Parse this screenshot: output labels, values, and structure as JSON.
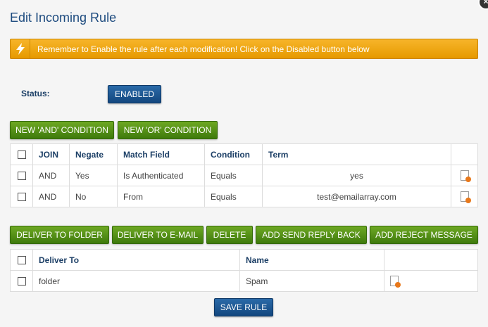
{
  "dialog": {
    "title": "Edit Incoming Rule",
    "close_glyph": "×",
    "notice": "Remember to Enable the rule after each modification! Click on the Disabled button below"
  },
  "status": {
    "label": "Status:",
    "button": "ENABLED"
  },
  "conditions": {
    "buttons": {
      "and": "NEW 'AND' CONDITION",
      "or": "NEW 'OR' CONDITION"
    },
    "headers": {
      "join": "JOIN",
      "negate": "Negate",
      "field": "Match Field",
      "condition": "Condition",
      "term": "Term"
    },
    "rows": [
      {
        "join": "AND",
        "negate": "Yes",
        "field": "Is Authenticated",
        "condition": "Equals",
        "term": "yes"
      },
      {
        "join": "AND",
        "negate": "No",
        "field": "From",
        "condition": "Equals",
        "term": "test@emailarray.com"
      }
    ]
  },
  "actions": {
    "buttons": {
      "folder": "DELIVER TO FOLDER",
      "email": "DELIVER TO E-MAIL",
      "delete": "DELETE",
      "reply": "ADD SEND REPLY BACK",
      "reject": "ADD REJECT MESSAGE"
    },
    "headers": {
      "deliver_to": "Deliver To",
      "name": "Name"
    },
    "rows": [
      {
        "deliver_to": "folder",
        "name": "Spam"
      }
    ]
  },
  "save": "SAVE RULE",
  "colors": {
    "title": "#1c4a7e",
    "notice": "#f0a820",
    "green": "#4f8f17",
    "blue": "#13477f"
  },
  "icons": [
    "close-icon",
    "lightning-icon",
    "document-edit-icon"
  ]
}
